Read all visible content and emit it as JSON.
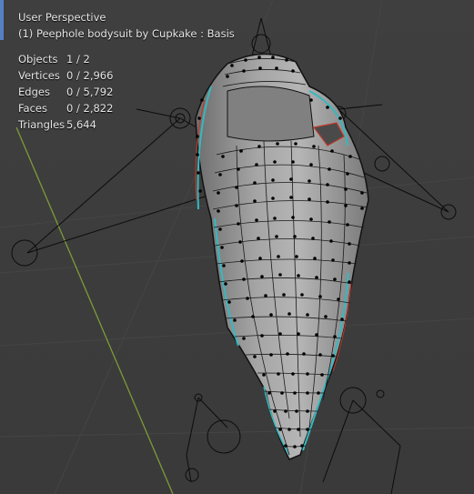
{
  "viewport": {
    "perspective_label": "User Perspective",
    "object_label": "(1) Peephole bodysuit by Cupkake : Basis"
  },
  "stats": [
    {
      "label": "Objects",
      "value": "1 / 2"
    },
    {
      "label": "Vertices",
      "value": "0 / 2,966"
    },
    {
      "label": "Edges",
      "value": "0 / 5,792"
    },
    {
      "label": "Faces",
      "value": "0 / 2,822"
    },
    {
      "label": "Triangles",
      "value": "5,644"
    }
  ],
  "colors": {
    "background": "#3d3d3d",
    "grid": "#4a4a4a",
    "axis_green": "#7e9a3a",
    "mesh_fill": "#9a9a9a",
    "vertex": "#000000",
    "seam": "#36b8c0",
    "edge_red": "#c0392b",
    "armature": "#0a0a0a",
    "active_marker": "#5680c2"
  }
}
